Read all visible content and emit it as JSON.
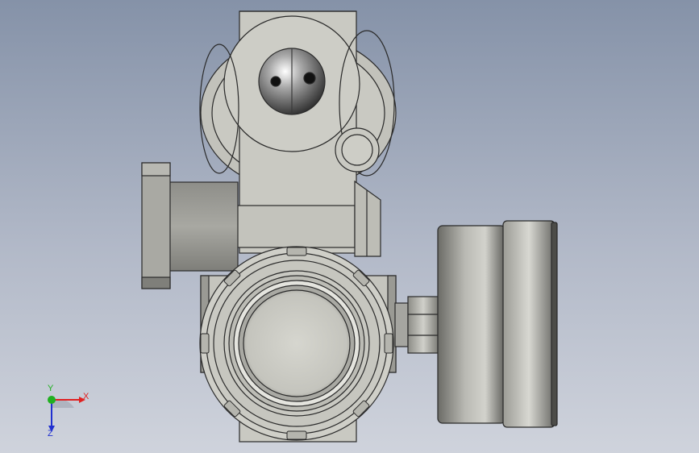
{
  "viewport": {
    "background_top": "#8592a8",
    "background_bottom": "#cfd3dc"
  },
  "model": {
    "body_color": "#c9c9c2",
    "edge_color": "#2a2a2a"
  },
  "triad": {
    "x_label": "X",
    "y_label": "Y",
    "z_label": "Z",
    "x_color": "#e02020",
    "y_color": "#20b020",
    "z_color": "#2030d0"
  }
}
